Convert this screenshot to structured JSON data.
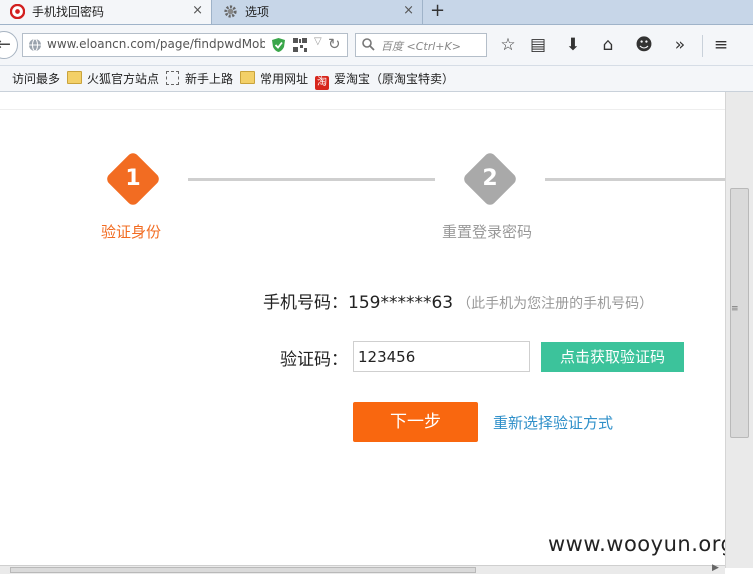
{
  "tabs": [
    {
      "label": "手机找回密码",
      "close": "×"
    },
    {
      "label": "选项",
      "close": "×"
    }
  ],
  "new_tab_label": "+",
  "address_bar": {
    "url": "www.eloancn.com/page/findpwdMob"
  },
  "search_bar": {
    "placeholder": "百度 <Ctrl+K>"
  },
  "toolbar_icons": [
    "star-icon",
    "reading-list-icon",
    "download-icon",
    "home-icon",
    "chat-icon",
    "overflow-icon",
    "menu-icon"
  ],
  "bookmarks": [
    {
      "label": "访问最多",
      "icon": "gear-icon"
    },
    {
      "label": "火狐官方站点",
      "icon": "folder-icon"
    },
    {
      "label": "新手上路",
      "icon": "page-icon"
    },
    {
      "label": "常用网址",
      "icon": "folder-icon"
    },
    {
      "label": "爱淘宝（原淘宝特卖）",
      "icon": "taobao-icon",
      "icon_text": "淘"
    }
  ],
  "steps": [
    {
      "number": "1",
      "label": "验证身份",
      "state": "active",
      "color": "#f26c22"
    },
    {
      "number": "2",
      "label": "重置登录密码",
      "state": "inactive",
      "color": "#a9a9a9"
    }
  ],
  "form": {
    "phone_label": "手机号码：",
    "phone_value": "159******63",
    "phone_note": "（此手机为您注册的手机号码）",
    "code_label": "验证码：",
    "code_value": "123456",
    "get_code_button": "点击获取验证码",
    "next_button": "下一步",
    "reselect_link": "重新选择验证方式"
  },
  "watermark": "www.wooyun.org",
  "colors": {
    "accent": "#f26c22",
    "green_button": "#3cc39b",
    "link": "#2e8fc9",
    "next_button": "#f9670f"
  }
}
